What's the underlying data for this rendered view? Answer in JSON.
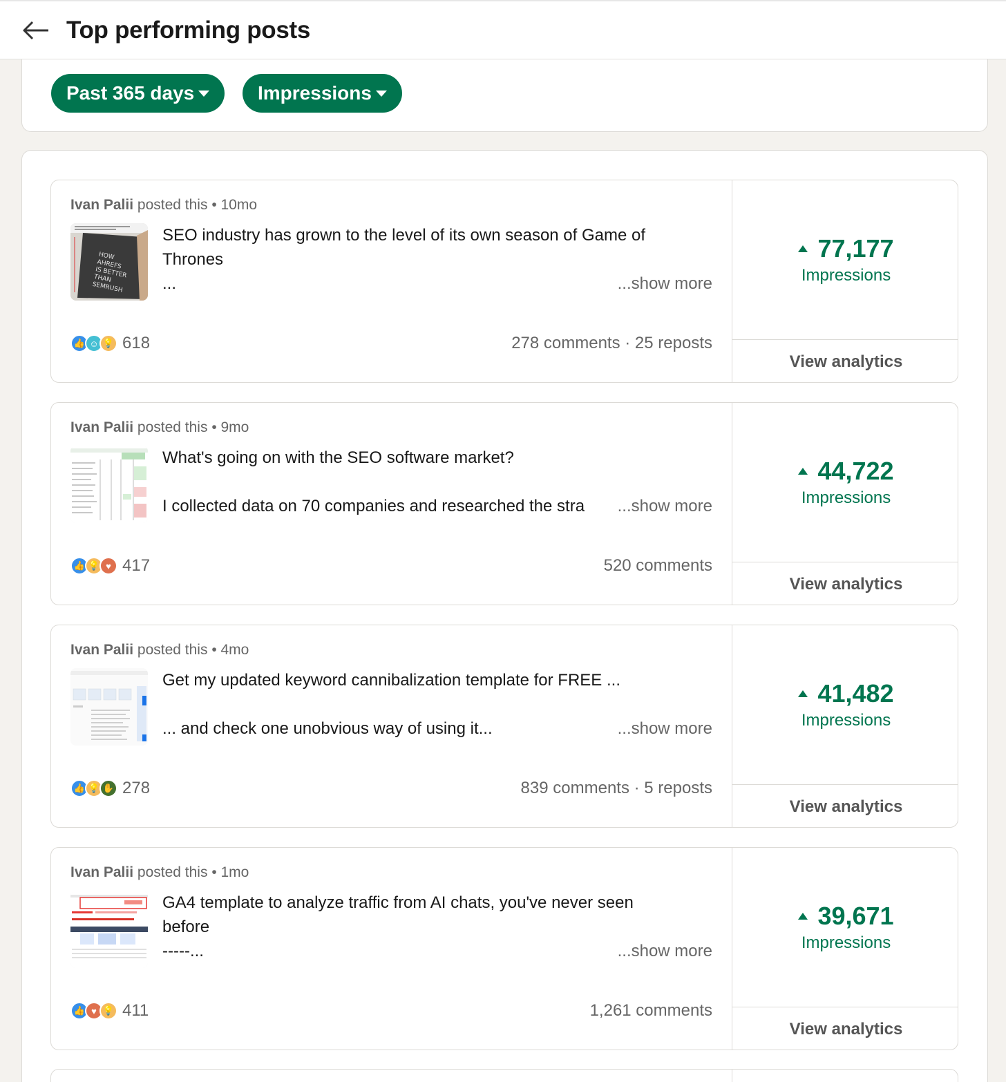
{
  "header": {
    "title": "Top performing posts"
  },
  "filters": [
    {
      "label": "Past 365 days"
    },
    {
      "label": "Impressions"
    }
  ],
  "posts": [
    {
      "author": "Ivan Palii",
      "action": "posted this",
      "age": "10mo",
      "line1": "SEO industry has grown to the level of its own season of Game of",
      "line2": "Thrones",
      "line3": "...",
      "show_more": "...show more",
      "reactions_count": "618",
      "engagement": "278 comments · 25 repost s",
      "impressions": "77,177",
      "impressions_label": "Impressions",
      "view_analytics": "View analytics",
      "reaction_icons": [
        "like",
        "funny",
        "insightful"
      ]
    },
    {
      "author": "Ivan Palii",
      "action": "posted this",
      "age": "9mo",
      "line1": "What's going on with the SEO software market?",
      "line2": "",
      "line3": "I collected data on 70 companies and researched the stra",
      "show_more": "...show more",
      "reactions_count": "417",
      "engagement": "520 comments",
      "impressions": "44,722",
      "impressions_label": "Impressions",
      "view_analytics": "View analytics",
      "reaction_icons": [
        "like",
        "insightful",
        "love"
      ]
    },
    {
      "author": "Ivan Palii",
      "action": "posted this",
      "age": "4mo",
      "line1": "Get my updated keyword cannibalization template for FREE ...",
      "line2": "",
      "line3": "... and check one unobvious way of using it...",
      "show_more": "...show more",
      "reactions_count": "278",
      "engagement": "839 comments · 5 reposts",
      "impressions": "41,482",
      "impressions_label": "Impressions",
      "view_analytics": "View analytics",
      "reaction_icons": [
        "like",
        "insightful",
        "support"
      ]
    },
    {
      "author": "Ivan Palii",
      "action": "posted this",
      "age": "1mo",
      "line1": "GA4 template to analyze traffic from AI chats, you've never seen",
      "line2": "before",
      "line3": "-----...",
      "show_more": "...show more",
      "reactions_count": "411",
      "engagement": "1,261 comments",
      "impressions": "39,671",
      "impressions_label": "Impressions",
      "view_analytics": "View analytics",
      "reaction_icons": [
        "like",
        "love",
        "insightful"
      ]
    }
  ],
  "thumbnail_1_text": [
    "HOW",
    "AHREFS",
    "IS BETTER",
    "THAN",
    "SEMRUSH"
  ],
  "colors": {
    "accent_green": "#01754f",
    "like_blue": "#378fe9",
    "insightful_yellow": "#f5bb5c",
    "love_red": "#df704d",
    "support_green": "#44712e",
    "funny_teal": "#44bfd3"
  }
}
